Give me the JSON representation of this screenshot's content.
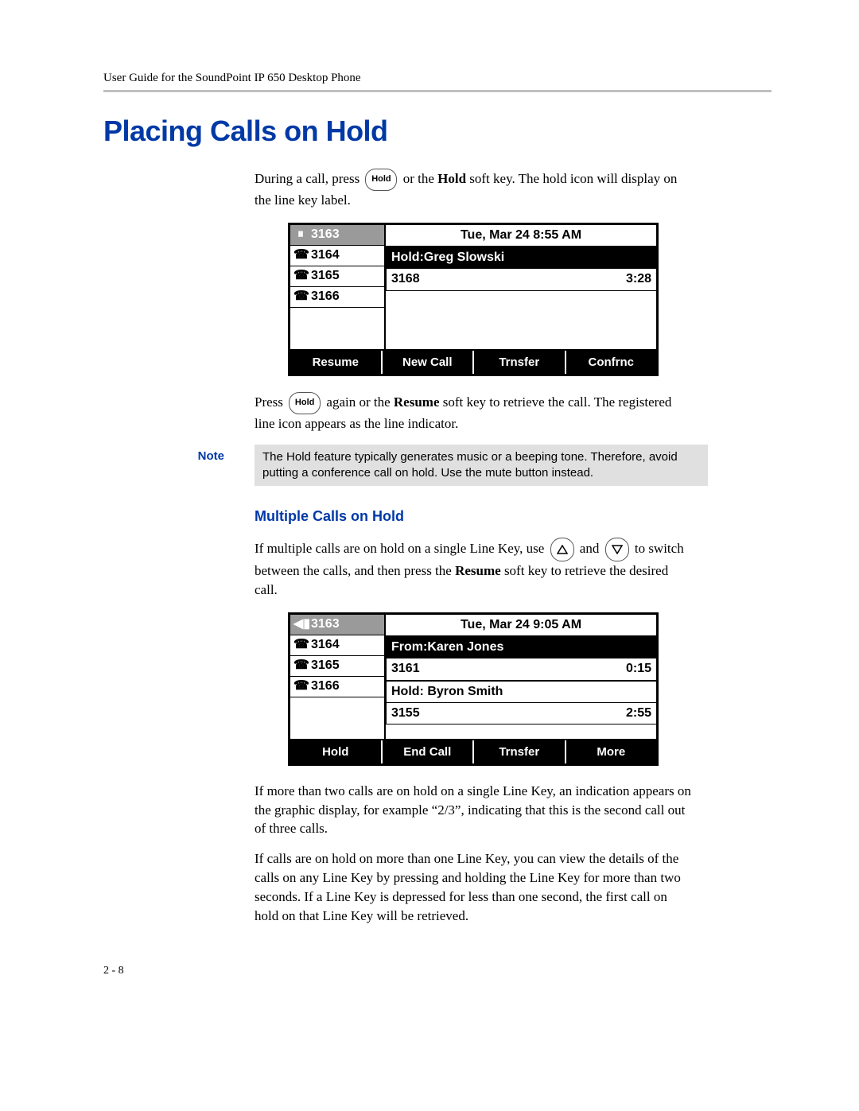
{
  "header": {
    "running_title": "User Guide for the SoundPoint IP 650 Desktop Phone"
  },
  "heading": "Placing Calls on Hold",
  "buttons": {
    "hold_label": "Hold"
  },
  "para1": {
    "pre": "During a call, press ",
    "mid": " or the ",
    "bold1": "Hold",
    "post": " soft key. The hold icon will display on the line key label."
  },
  "lcd1": {
    "lines": [
      "3163",
      "3164",
      "3165",
      "3166"
    ],
    "title": "Tue, Mar 24  8:55 AM",
    "call_header": "Hold:Greg Slowski",
    "call_number": "3168",
    "call_timer": "3:28",
    "softkeys": [
      "Resume",
      "New Call",
      "Trnsfer",
      "Confrnc"
    ]
  },
  "para2": {
    "pre": "Press ",
    "mid": " again or the ",
    "bold1": "Resume",
    "post": " soft key to retrieve the call. The registered line icon appears as the line indicator."
  },
  "note": {
    "label": "Note",
    "text": "The Hold feature typically generates music or a beeping tone. Therefore, avoid putting a conference call on hold. Use the mute button instead."
  },
  "subheading": "Multiple Calls on Hold",
  "para3": {
    "pre": "If multiple calls are on hold on a single Line Key, use ",
    "mid": " and ",
    "post1": " to switch between the calls, and then press the ",
    "bold1": "Resume",
    "post2": " soft key to retrieve the desired call."
  },
  "lcd2": {
    "lines": [
      "3163",
      "3164",
      "3165",
      "3166"
    ],
    "title": "Tue, Mar 24  9:05 AM",
    "call1_header": "From:Karen Jones",
    "call1_number": "3161",
    "call1_timer": "0:15",
    "call2_header": "Hold: Byron Smith",
    "call2_number": "3155",
    "call2_timer": "2:55",
    "softkeys": [
      "Hold",
      "End Call",
      "Trnsfer",
      "More"
    ]
  },
  "para4": "If more than two calls are on hold on a single Line Key, an indication appears on the graphic display, for example “2/3”, indicating that this is the second call out of three calls.",
  "para5": "If calls are on hold on more than one Line Key, you can view the details of the calls on any Line Key by pressing and holding the Line Key for more than two seconds. If a Line Key is depressed for less than one second, the first call on hold on that Line Key will be retrieved.",
  "footer": "2 - 8"
}
